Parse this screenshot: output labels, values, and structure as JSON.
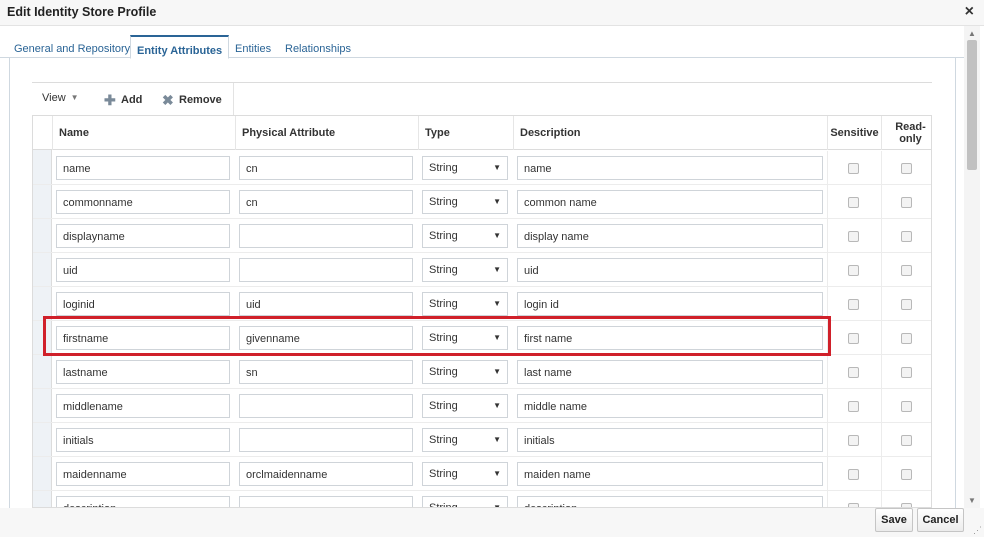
{
  "dialog": {
    "title": "Edit Identity Store Profile",
    "close_glyph": "×"
  },
  "tabs": [
    {
      "label": "General and Repository"
    },
    {
      "label": "Entity Attributes"
    },
    {
      "label": "Entities"
    },
    {
      "label": "Relationships"
    }
  ],
  "toolbar": {
    "view_label": "View",
    "view_caret": "▼",
    "add_label": "Add",
    "remove_label": "Remove",
    "add_glyph": "✚",
    "remove_glyph": "✖"
  },
  "columns": {
    "name": "Name",
    "physical": "Physical Attribute",
    "type": "Type",
    "description": "Description",
    "sensitive": "Sensitive",
    "readonly_1": "Read-",
    "readonly_2": "only"
  },
  "rows": [
    {
      "name": "name",
      "physical": "cn",
      "type": "String",
      "description": "name"
    },
    {
      "name": "commonname",
      "physical": "cn",
      "type": "String",
      "description": "common name"
    },
    {
      "name": "displayname",
      "physical": "",
      "type": "String",
      "description": "display name"
    },
    {
      "name": "uid",
      "physical": "",
      "type": "String",
      "description": "uid"
    },
    {
      "name": "loginid",
      "physical": "uid",
      "type": "String",
      "description": "login id"
    },
    {
      "name": "firstname",
      "physical": "givenname",
      "type": "String",
      "description": "first name"
    },
    {
      "name": "lastname",
      "physical": "sn",
      "type": "String",
      "description": "last name"
    },
    {
      "name": "middlename",
      "physical": "",
      "type": "String",
      "description": "middle name"
    },
    {
      "name": "initials",
      "physical": "",
      "type": "String",
      "description": "initials"
    },
    {
      "name": "maidenname",
      "physical": "orclmaidenname",
      "type": "String",
      "description": "maiden name"
    },
    {
      "name": "description",
      "physical": "",
      "type": "String",
      "description": "description"
    }
  ],
  "select_arrow": "▼",
  "footer": {
    "save_label": "Save",
    "cancel_label": "Cancel",
    "grip_glyph": "⋰"
  },
  "colors": {
    "accent": "#2a6496",
    "highlight": "#d0202a"
  }
}
